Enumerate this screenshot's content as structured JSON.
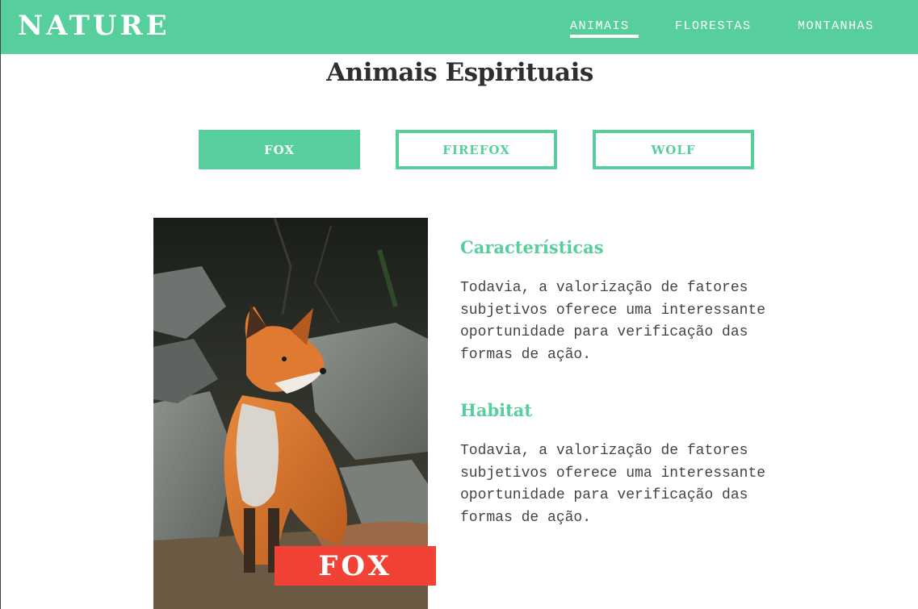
{
  "brand": "NATURE",
  "nav": {
    "items": [
      {
        "label": "ANIMAIS",
        "active": true
      },
      {
        "label": "FLORESTAS",
        "active": false
      },
      {
        "label": "MONTANHAS",
        "active": false
      }
    ]
  },
  "page_title": "Animais Espirituais",
  "tabs": [
    {
      "label": "FOX",
      "active": true
    },
    {
      "label": "FIREFOX",
      "active": false
    },
    {
      "label": "WOLF",
      "active": false
    }
  ],
  "photo": {
    "label": "FOX",
    "subject": "fox-photo"
  },
  "sections": [
    {
      "heading": "Características",
      "text": "Todavia, a valorização de fatores subjetivos oferece uma interessante oportunidade para verificação das formas de ação."
    },
    {
      "heading": "Habitat",
      "text": "Todavia, a valorização de fatores subjetivos oferece uma interessante oportunidade para verificação das formas de ação."
    }
  ],
  "colors": {
    "accent": "#57cf9c",
    "label_red": "#f24236",
    "text_dark": "#2f2f2f",
    "text_body": "#444444"
  }
}
